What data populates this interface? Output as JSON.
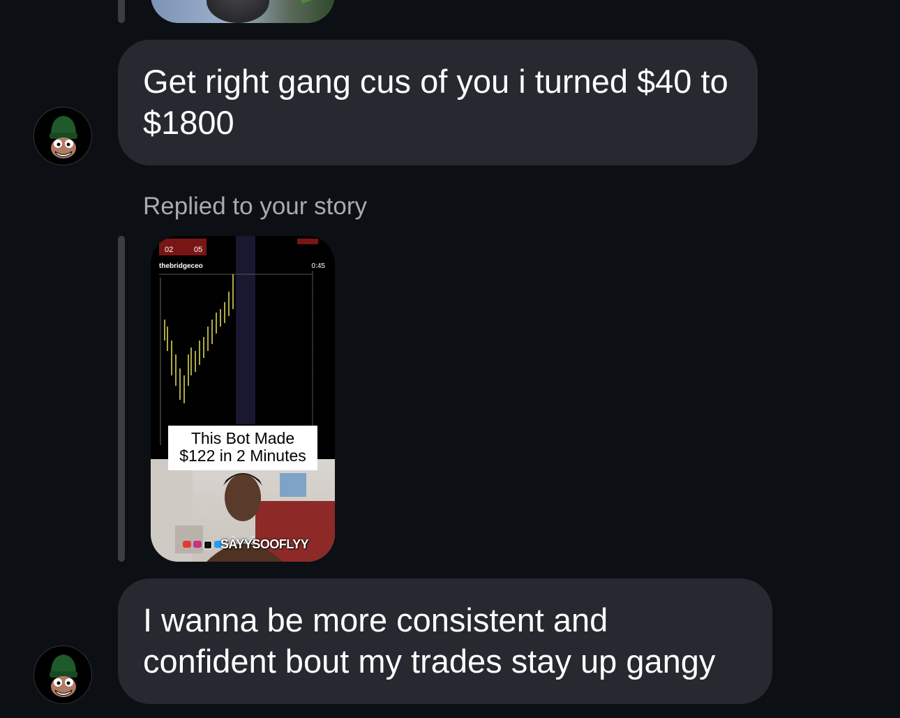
{
  "messages": [
    {
      "id": "msg1",
      "text": "Get right gang cus of you i turned $40 to $1800"
    },
    {
      "id": "msg2",
      "text": "I wanna be more consistent and confident bout my trades stay up gangy"
    }
  ],
  "story_reply": {
    "label": "Replied to your story",
    "story": {
      "username": "thebridgeceo",
      "timer": "0:45",
      "caption_line1": "This Bot Made",
      "caption_line2": "$122 in 2 Minutes",
      "handle": "SAYYSOOFLYY"
    }
  },
  "colors": {
    "background": "#0c1014",
    "bubble": "#26292f",
    "muted_text": "#a8abb0"
  },
  "icons": {
    "avatar": "cartoon-green-beanie-avatar",
    "social": [
      "youtube-icon",
      "instagram-icon",
      "tiktok-icon",
      "twitter-icon"
    ]
  }
}
